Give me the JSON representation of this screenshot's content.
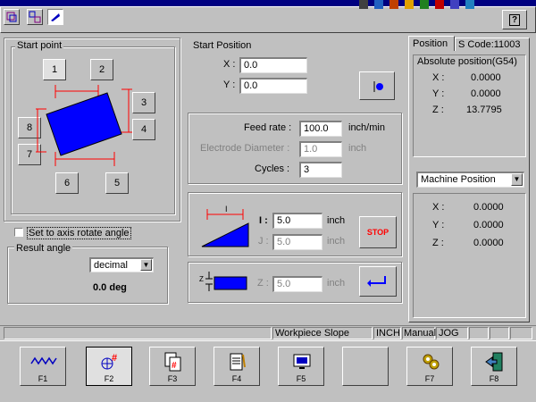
{
  "toolbar": {
    "mode_icons": [
      "rotate-icon",
      "align-icon",
      "slope-icon"
    ],
    "help_label": "?",
    "tray_icons": [
      "tray-icon-1",
      "tray-icon-2",
      "tray-icon-3",
      "tray-icon-4",
      "tray-icon-5",
      "tray-icon-6",
      "tray-icon-7",
      "tray-icon-8"
    ]
  },
  "start_point": {
    "title": "Start point",
    "points": [
      "1",
      "2",
      "3",
      "4",
      "5",
      "6",
      "7",
      "8"
    ]
  },
  "start_position": {
    "title": "Start Position",
    "x_label": "X :",
    "x_value": "0.0",
    "y_label": "Y :",
    "y_value": "0.0"
  },
  "feed": {
    "feed_rate_label": "Feed rate :",
    "feed_rate_value": "100.0",
    "feed_rate_unit": "inch/min",
    "electrode_label": "Electrode Diameter :",
    "electrode_value": "1.0",
    "electrode_unit": "inch",
    "cycles_label": "Cycles :",
    "cycles_value": "3"
  },
  "slope": {
    "i_label": "I :",
    "i_value": "5.0",
    "i_unit": "inch",
    "j_label": "J :",
    "j_value": "5.0",
    "j_unit": "inch",
    "stop_label": "STOP",
    "diagram_label": "I"
  },
  "zfield": {
    "z_label": "Z :",
    "z_value": "5.0",
    "z_unit": "inch",
    "diagram_label": "Z"
  },
  "axis_rotate": {
    "checkbox_label": "Set to axis rotate angle",
    "checked": false
  },
  "result_angle": {
    "title": "Result angle",
    "format_selected": "decimal",
    "value": "0.0 deg"
  },
  "position_panel": {
    "tabs": [
      "Position",
      "S Code:11003"
    ],
    "abs_title": "Absolute position(G54)",
    "abs": [
      {
        "axis": "X :",
        "value": "0.0000"
      },
      {
        "axis": "Y :",
        "value": "0.0000"
      },
      {
        "axis": "Z :",
        "value": "13.7795"
      }
    ],
    "machine_selected": "Machine Position",
    "machine": [
      {
        "axis": "X :",
        "value": "0.0000"
      },
      {
        "axis": "Y :",
        "value": "0.0000"
      },
      {
        "axis": "Z :",
        "value": "0.0000"
      }
    ]
  },
  "status_bar": {
    "mode": "Workpiece Slope",
    "unit": "INCH",
    "op": "Manual",
    "jog": "JOG"
  },
  "function_keys": [
    {
      "key": "F1",
      "icon": "wave-icon"
    },
    {
      "key": "F2",
      "icon": "target-hash-icon"
    },
    {
      "key": "F3",
      "icon": "pages-hash-icon"
    },
    {
      "key": "F4",
      "icon": "notepad-icon"
    },
    {
      "key": "F5",
      "icon": "monitor-icon"
    },
    {
      "key": "",
      "icon": ""
    },
    {
      "key": "F7",
      "icon": "gears-icon"
    },
    {
      "key": "F8",
      "icon": "exit-door-icon"
    }
  ],
  "colors": {
    "face": "#c0c0c0",
    "title_bar": "#000080",
    "blue_shape": "#0000ff",
    "red_dim": "#ff0000",
    "stop_red": "#ff0000"
  }
}
